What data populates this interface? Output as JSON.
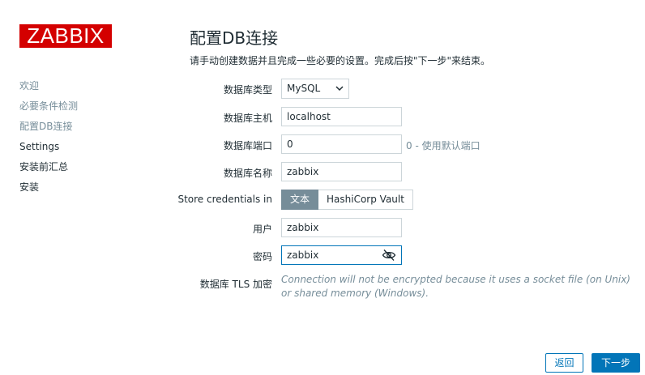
{
  "logo": "ZABBIX",
  "sidebar": {
    "steps": [
      {
        "label": "欢迎",
        "state": "done"
      },
      {
        "label": "必要条件检测",
        "state": "done"
      },
      {
        "label": "配置DB连接",
        "state": "done"
      },
      {
        "label": "Settings",
        "state": "current"
      },
      {
        "label": "安装前汇总",
        "state": "pending"
      },
      {
        "label": "安装",
        "state": "pending"
      }
    ]
  },
  "main": {
    "title": "配置DB连接",
    "intro": "请手动创建数据并且完成一些必要的设置。完成后按\"下一步\"来结束。",
    "form": {
      "db_type": {
        "label": "数据库类型",
        "value": "MySQL"
      },
      "db_host": {
        "label": "数据库主机",
        "value": "localhost"
      },
      "db_port": {
        "label": "数据库端口",
        "value": "0",
        "hint": "0 - 使用默认端口"
      },
      "db_name": {
        "label": "数据库名称",
        "value": "zabbix"
      },
      "store_credentials": {
        "label": "Store credentials in",
        "options": [
          "文本",
          "HashiCorp Vault"
        ],
        "selected": "文本"
      },
      "user": {
        "label": "用户",
        "value": "zabbix"
      },
      "password": {
        "label": "密码",
        "value": "zabbix"
      },
      "tls": {
        "label": "数据库 TLS 加密",
        "message": "Connection will not be encrypted because it uses a socket file (on Unix) or shared memory (Windows)."
      }
    }
  },
  "footer": {
    "back_label": "返回",
    "next_label": "下一步"
  },
  "colors": {
    "brand": "#d40000",
    "accent": "#0275b8",
    "muted": "#768d99"
  }
}
